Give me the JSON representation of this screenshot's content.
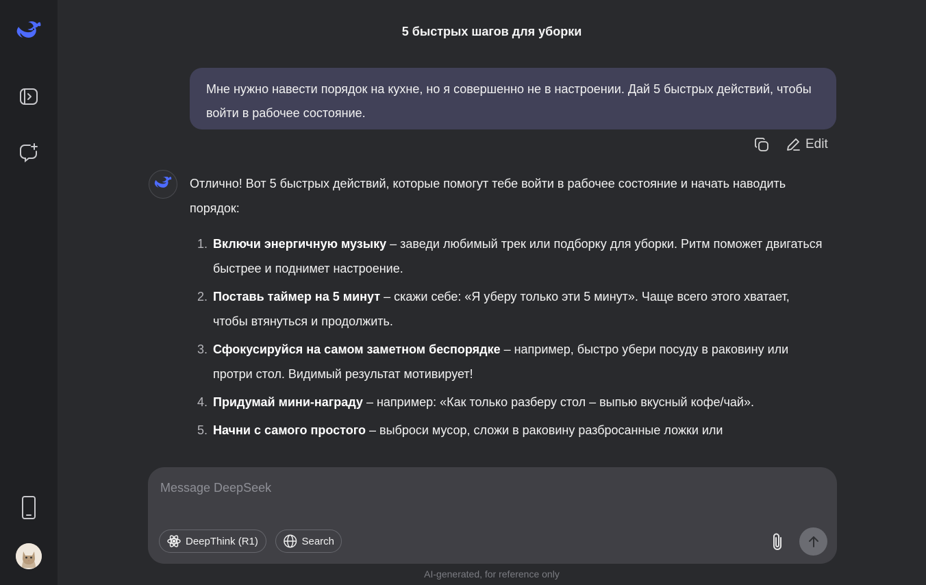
{
  "chat": {
    "title": "5 быстрых шагов для уборки",
    "user_message": "Мне нужно навести порядок на кухне, но я совершенно не в настроении. Дай 5 быстрых действий, чтобы войти в рабочее состояние.",
    "edit_label": "Edit",
    "bot_intro": "Отлично! Вот 5 быстрых действий, которые помогут тебе войти в рабочее состояние и начать наводить порядок:",
    "steps": [
      {
        "num": "1.",
        "bold": "Включи энергичную музыку",
        "text": " – заведи любимый трек или подборку для уборки. Ритм поможет двигаться быстрее и поднимет настроение."
      },
      {
        "num": "2.",
        "bold": "Поставь таймер на 5 минут",
        "text": " – скажи себе: «Я уберу только эти 5 минут». Чаще всего этого хватает, чтобы втянуться и продолжить."
      },
      {
        "num": "3.",
        "bold": "Сфокусируйся на самом заметном беспорядке",
        "text": " – например, быстро убери посуду в раковину или протри стол. Видимый результат мотивирует!"
      },
      {
        "num": "4.",
        "bold": "Придумай мини-награду",
        "text": " – например: «Как только разберу стол – выпью вкусный кофе/чай»."
      },
      {
        "num": "5.",
        "bold": "Начни с самого простого",
        "text": " – выброси мусор, сложи в раковину разбросанные ложки или"
      }
    ]
  },
  "composer": {
    "placeholder": "Message DeepSeek",
    "deepthink_label": "DeepThink (R1)",
    "search_label": "Search"
  },
  "footer": "AI-generated, for reference only",
  "colors": {
    "accent": "#4d6bfe",
    "background": "#292a2d",
    "sidebar": "#1f2023",
    "user_bubble": "#414158",
    "composer": "#404045"
  },
  "icons": {
    "logo": "deepseek-whale-icon",
    "toggle": "sidebar-toggle-icon",
    "newchat": "new-chat-icon",
    "phone": "mobile-app-icon",
    "copy": "copy-icon",
    "edit": "pencil-icon",
    "deepthink": "atom-icon",
    "search": "globe-icon",
    "attach": "paperclip-icon",
    "send": "arrow-up-icon"
  }
}
